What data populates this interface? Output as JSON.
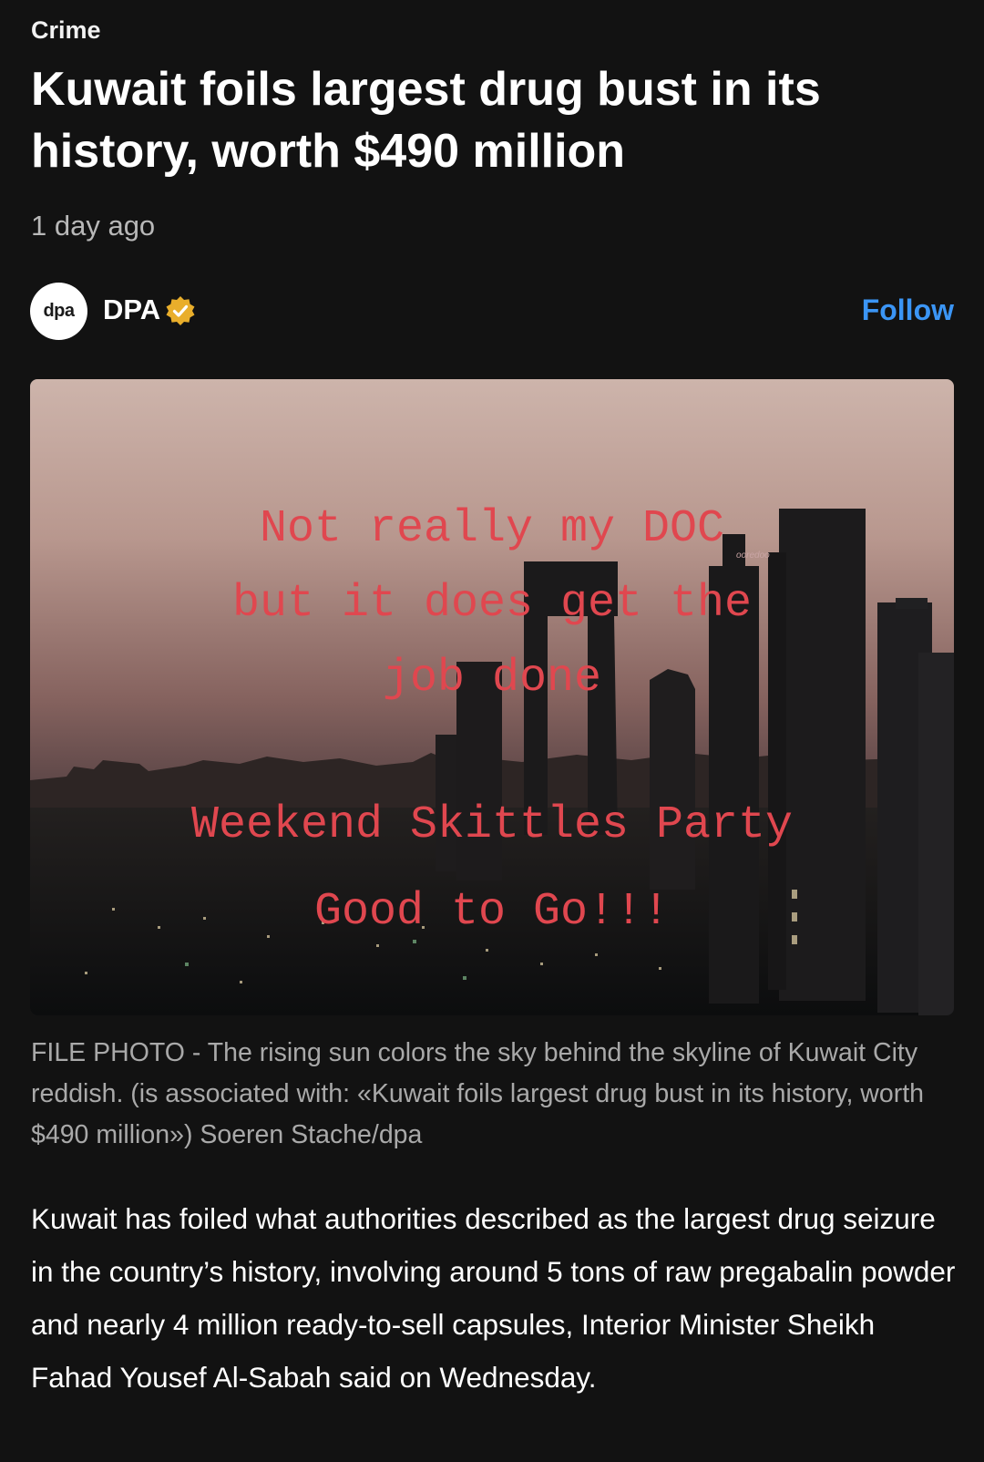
{
  "article": {
    "category": "Crime",
    "headline": "Kuwait foils largest drug bust in its history, worth $490 million",
    "timestamp": "1 day ago"
  },
  "source": {
    "avatar_text": "dpa",
    "name": "DPA",
    "verified_icon": "verified-badge-icon",
    "follow_label": "Follow",
    "follow_color": "#3b95f5"
  },
  "photo": {
    "overlay_top": [
      "Not really my DOC",
      "but it does get the",
      "job done"
    ],
    "overlay_bottom": [
      "Weekend Skittles Party",
      "Good to Go!!!"
    ],
    "overlay_color": "#e0474f",
    "building_sign": "ooredoo"
  },
  "caption": "FILE PHOTO - The rising sun colors the sky behind the skyline of Kuwait City reddish. (is associated with: «Kuwait foils largest drug bust in its history, worth $490 million») Soeren Stache/dpa",
  "body": "Kuwait has foiled what authorities described as the largest drug seizure in the country’s history, involving around 5 tons of raw pregabalin powder and nearly 4 million ready-to-sell capsules, Interior Minister Sheikh Fahad Yousef Al-Sabah said on Wednesday."
}
